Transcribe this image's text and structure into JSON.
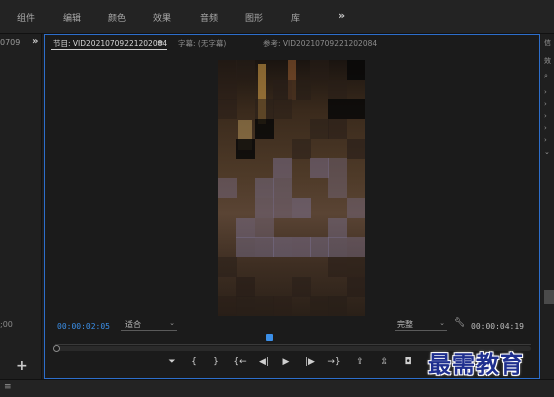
{
  "workspaces": [
    "组件",
    "编辑",
    "颜色",
    "效果",
    "音频",
    "图形",
    "库"
  ],
  "workspace_more": "»",
  "left_panel": {
    "title": "0709",
    "more": "»",
    "timecode": ";00",
    "add": "+"
  },
  "monitor": {
    "tabs": {
      "program": "节目: VID20210709221202084",
      "program_menu": "≡",
      "captions": "字幕: (无字幕)",
      "reference": "参考: VID20210709221202084"
    },
    "current_time": "00:00:02:05",
    "fit": "适合",
    "quality": "完整",
    "duration": "00:00:04:19"
  },
  "controls": {
    "marker": "⏷",
    "mark_in": "{",
    "mark_out": "}",
    "go_to_in": "{←",
    "step_back": "◀|",
    "play": "▶",
    "step_forward": "|▶",
    "go_to_out": "→}",
    "lift": "⇪",
    "extract": "⇫",
    "export_frame": "◘"
  },
  "right_panel": {
    "items": [
      "信",
      "效",
      "⌕",
      "›",
      "›",
      "›",
      "›",
      "›",
      "⌄"
    ]
  },
  "bottom_menu": "≡",
  "watermark": "最需教育",
  "colors": {
    "accent": "#3b8fe8",
    "panel_border": "#2d6ecb"
  }
}
